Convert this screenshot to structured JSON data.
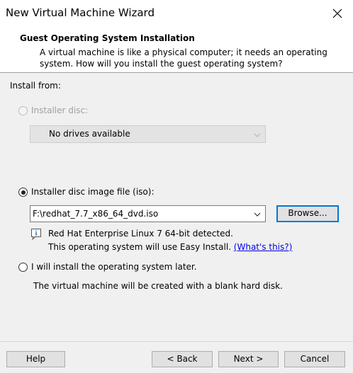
{
  "window": {
    "title": "New Virtual Machine Wizard",
    "close_icon": "close-icon"
  },
  "header": {
    "title": "Guest Operating System Installation",
    "description": "A virtual machine is like a physical computer; it needs an operating system. How will you install the guest operating system?"
  },
  "install_from": {
    "label": "Install from:",
    "disc": {
      "label": "Installer disc:",
      "selected": false,
      "enabled": false,
      "dropdown_value": "No drives available"
    },
    "iso": {
      "label": "Installer disc image file (iso):",
      "selected": true,
      "path_value": "F:\\redhat_7.7_x86_64_dvd.iso",
      "browse_label": "Browse...",
      "info_icon": "info-icon",
      "detected_text": "Red Hat Enterprise Linux 7 64-bit detected.",
      "easy_install_text": "This operating system will use Easy Install.",
      "whats_this_link": "(What's this?)"
    },
    "later": {
      "label": "I will install the operating system later.",
      "selected": false,
      "description": "The virtual machine will be created with a blank hard disk."
    }
  },
  "footer": {
    "help_label": "Help",
    "back_label": "< Back",
    "next_label": "Next >",
    "cancel_label": "Cancel"
  },
  "colors": {
    "accent": "#0078d7",
    "link": "#0000ee",
    "dialog_bg": "#f0f0f0"
  }
}
